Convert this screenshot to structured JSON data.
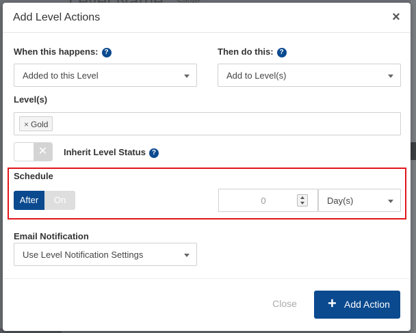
{
  "background": {
    "title": "Level Name",
    "subtitle": "Silver"
  },
  "modal": {
    "title": "Add Level Actions",
    "close_icon": "close-icon"
  },
  "trigger": {
    "label": "When this happens:",
    "value": "Added to this Level"
  },
  "action": {
    "label": "Then do this:",
    "value": "Add to Level(s)"
  },
  "levels": {
    "label": "Level(s)",
    "tags": [
      "Gold"
    ],
    "tag_remove": "×"
  },
  "inherit": {
    "label": "Inherit Level Status",
    "toggle_off_glyph": "✕",
    "enabled": false
  },
  "schedule": {
    "label": "Schedule",
    "options": [
      "After",
      "On"
    ],
    "selected": "After",
    "amount": "0",
    "unit": "Day(s)"
  },
  "email": {
    "label": "Email Notification",
    "value": "Use Level Notification Settings"
  },
  "footer": {
    "close_label": "Close",
    "add_label": "Add Action",
    "add_icon": "+"
  },
  "colors": {
    "primary": "#0b4a8f",
    "highlight": "#e0141a"
  }
}
